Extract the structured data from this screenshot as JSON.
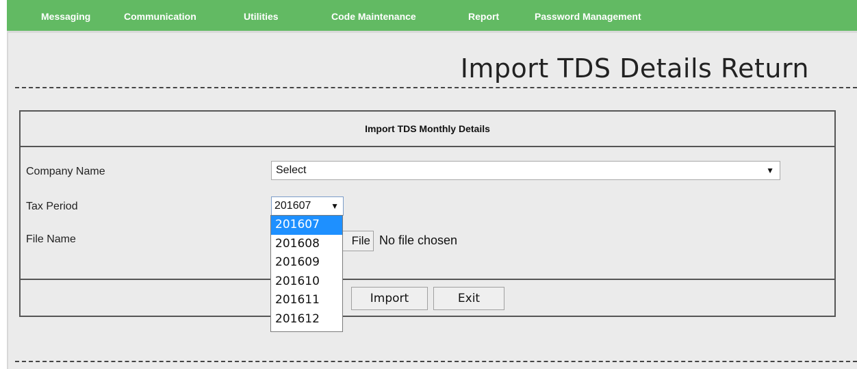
{
  "nav": {
    "items": [
      "Messaging",
      "Communication",
      "Utilities",
      "Code Maintenance",
      "Report",
      "Password Management"
    ]
  },
  "page": {
    "title": "Import TDS Details Return"
  },
  "panel": {
    "header": "Import TDS Monthly Details",
    "fields": {
      "company_label": "Company Name",
      "company_value": "Select",
      "tax_label": "Tax Period",
      "tax_value": "201607",
      "file_label": "File Name",
      "file_button": "File",
      "file_status": "No file chosen"
    },
    "buttons": {
      "import": "Import",
      "exit": "Exit"
    }
  },
  "dropdown": {
    "options": [
      "201607",
      "201608",
      "201609",
      "201610",
      "201611",
      "201612"
    ],
    "selected": "201607"
  },
  "icons": {
    "select_arrow": "▼"
  },
  "colors": {
    "nav_bg": "#62ba63",
    "highlight": "#1e90ff"
  }
}
